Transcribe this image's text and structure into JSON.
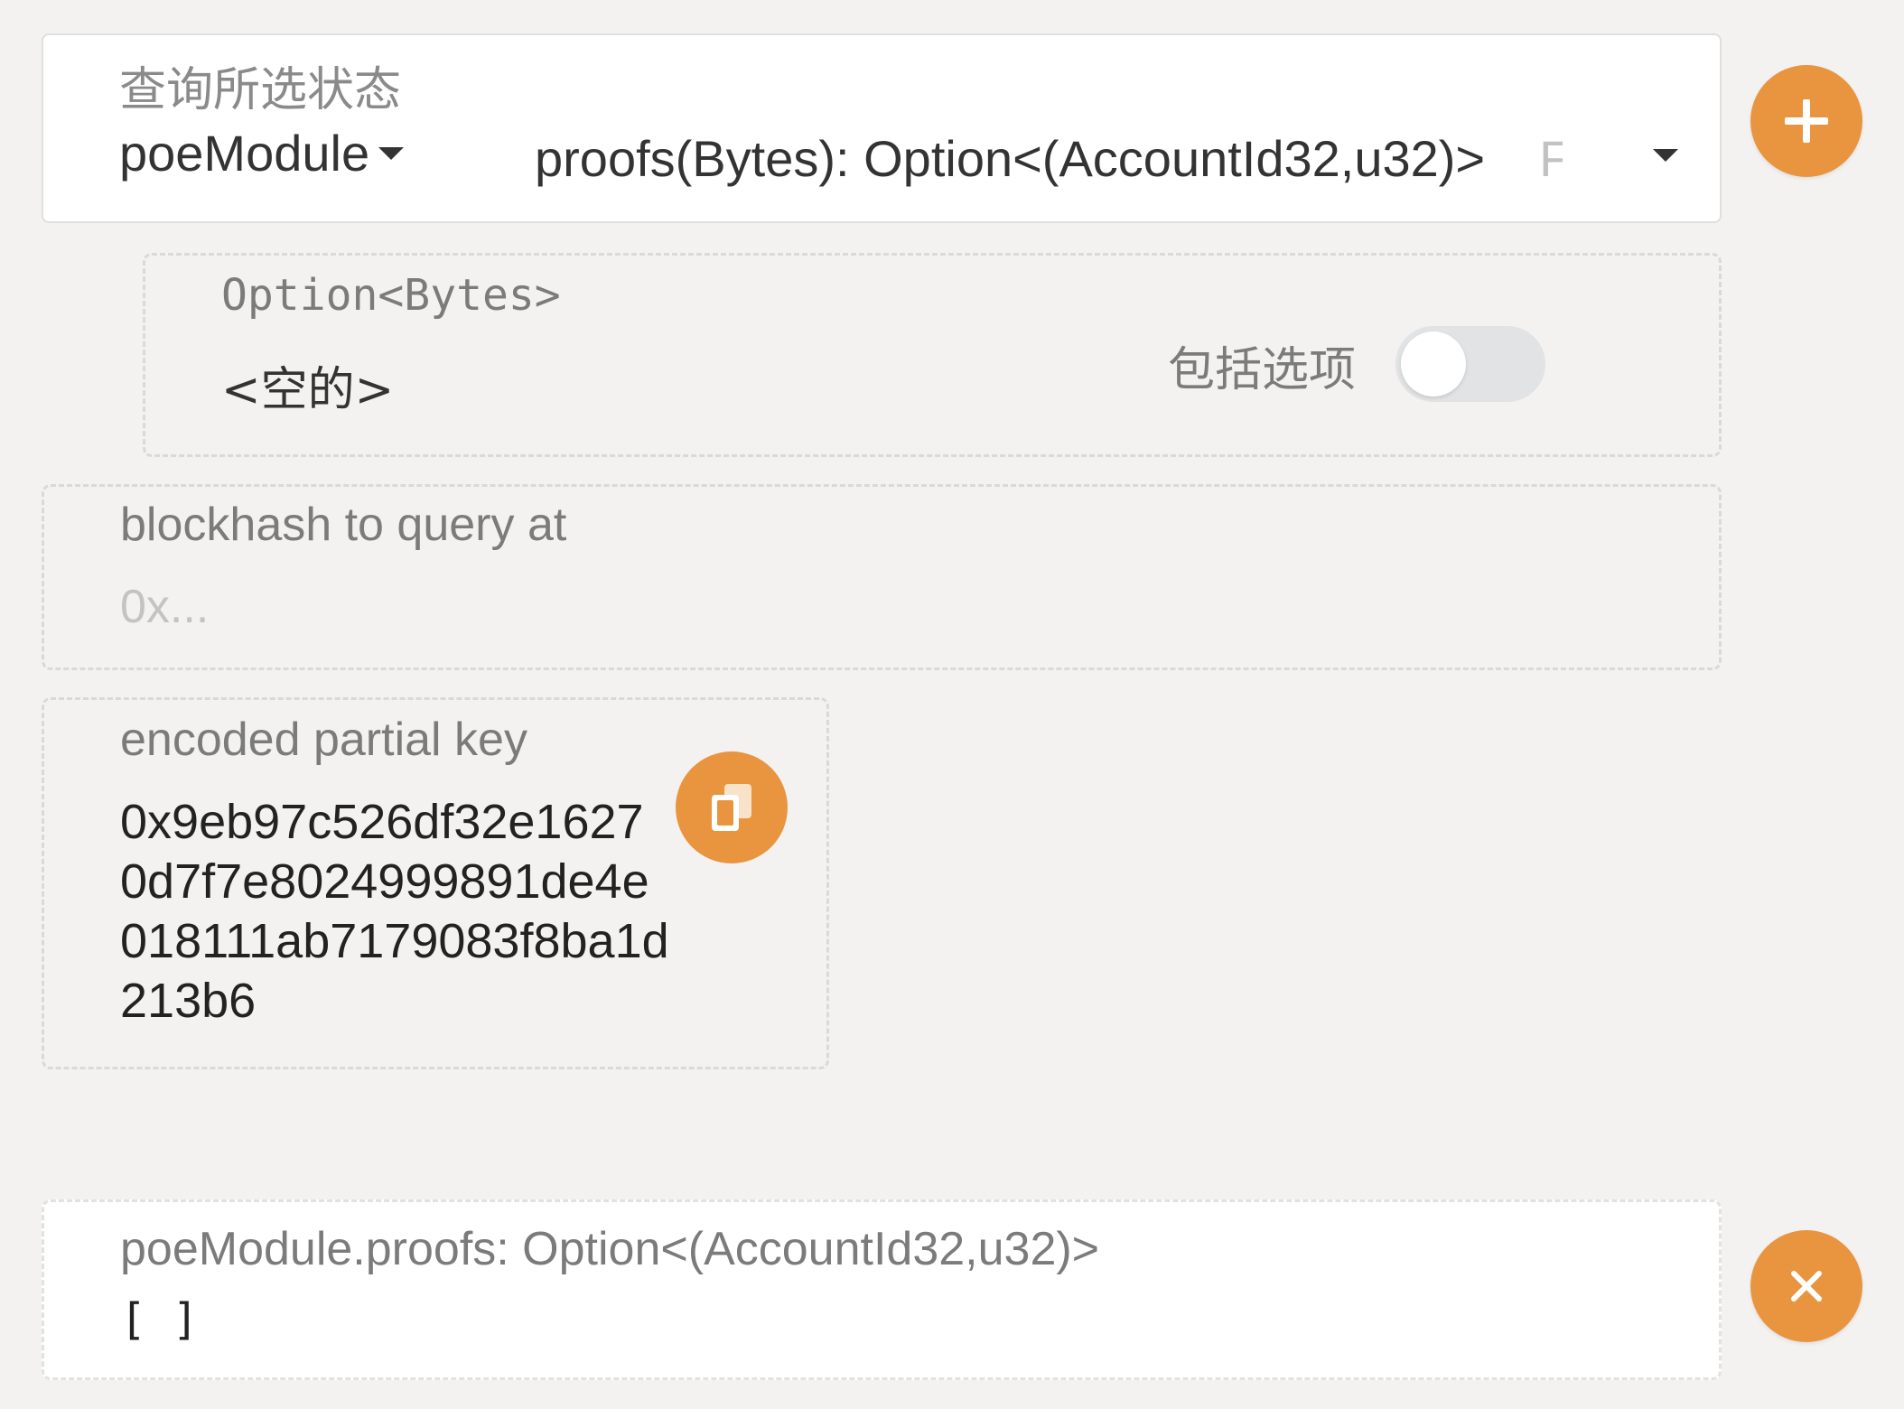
{
  "query": {
    "label": "查询所选状态",
    "module": "poeModule",
    "method": "proofs(Bytes): Option<(AccountId32,u32)>",
    "method_desc_fragment": "F"
  },
  "add_button_icon": "plus-icon",
  "param": {
    "type_label": "Option<Bytes>",
    "value": "<空的>",
    "include_label": "包括选项",
    "include_enabled": false
  },
  "blockhash": {
    "label": "blockhash to query at",
    "placeholder": "0x..."
  },
  "partial_key": {
    "label": "encoded partial key",
    "lines": [
      "0x9eb97c526df32e1627",
      "0d7f7e8024999891de4e",
      "018111ab7179083f8ba1d",
      "213b6"
    ],
    "copy_icon": "copy-icon"
  },
  "result": {
    "label": "poeModule.proofs: Option<(AccountId32,u32)>",
    "value": "[ ]",
    "close_icon": "close-icon"
  },
  "colors": {
    "accent": "#e99540",
    "background": "#f3f2f1",
    "card": "#ffffff"
  }
}
